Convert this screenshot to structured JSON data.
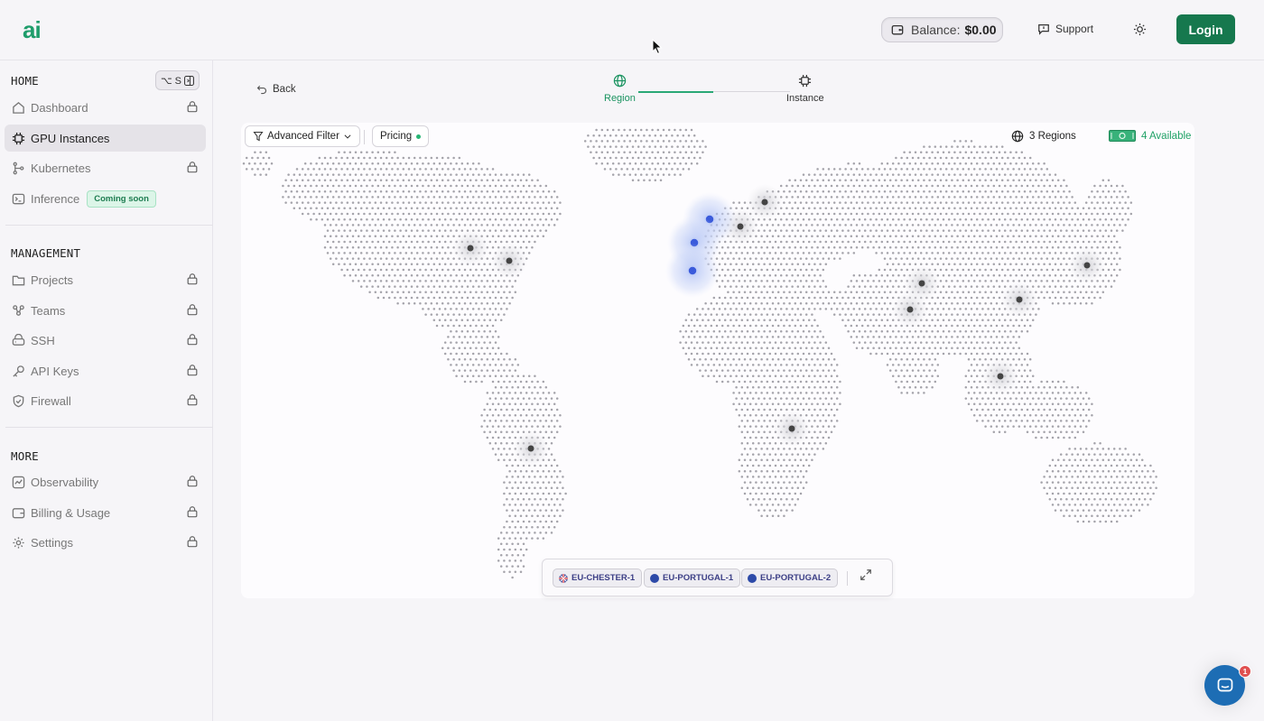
{
  "header": {
    "logo": "ai",
    "balance_label": "Balance:",
    "balance_amount": "$0.00",
    "support_label": "Support",
    "login_label": "Login"
  },
  "sidebar": {
    "home_title": "HOME",
    "shortcut": "⌥ S",
    "home_items": [
      {
        "label": "Dashboard",
        "locked": true
      },
      {
        "label": "GPU Instances",
        "locked": false,
        "active": true
      },
      {
        "label": "Kubernetes",
        "locked": true
      },
      {
        "label": "Inference",
        "badge": "Coming soon"
      }
    ],
    "management_title": "MANAGEMENT",
    "management_items": [
      {
        "label": "Projects",
        "locked": true
      },
      {
        "label": "Teams",
        "locked": true
      },
      {
        "label": "SSH",
        "locked": true
      },
      {
        "label": "API Keys",
        "locked": true
      },
      {
        "label": "Firewall",
        "locked": true
      }
    ],
    "more_title": "MORE",
    "more_items": [
      {
        "label": "Observability",
        "locked": true
      },
      {
        "label": "Billing & Usage",
        "locked": true
      },
      {
        "label": "Settings",
        "locked": true
      }
    ]
  },
  "main": {
    "back_label": "Back",
    "steps": [
      {
        "label": "Region",
        "state": "active"
      },
      {
        "label": "Instance",
        "state": "pending"
      }
    ],
    "filter_label": "Advanced Filter",
    "pricing_label": "Pricing",
    "regions_count": "3 Regions",
    "available_count": "4 Available",
    "selected_regions": [
      {
        "name": "EU-CHESTER-1",
        "flag": "uk"
      },
      {
        "name": "EU-PORTUGAL-1",
        "flag": "globe"
      },
      {
        "name": "EU-PORTUGAL-2",
        "flag": "globe"
      }
    ]
  },
  "chat": {
    "unread": "1"
  },
  "colors": {
    "brand": "#16784e",
    "accent_green": "#1a9360",
    "selected_marker": "#3b5bdb",
    "inactive_marker": "#444444"
  }
}
